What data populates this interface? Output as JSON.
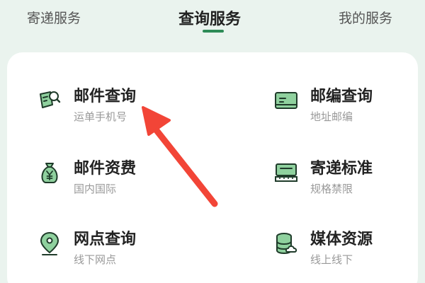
{
  "tabs": [
    {
      "label": "寄递服务",
      "active": false
    },
    {
      "label": "查询服务",
      "active": true
    },
    {
      "label": "我的服务",
      "active": false
    }
  ],
  "services": [
    {
      "title": "邮件查询",
      "subtitle": "运单手机号",
      "icon": "mail-search-icon"
    },
    {
      "title": "邮编查询",
      "subtitle": "地址邮编",
      "icon": "postcode-card-icon"
    },
    {
      "title": "邮件资费",
      "subtitle": "国内国际",
      "icon": "money-bag-icon"
    },
    {
      "title": "寄递标准",
      "subtitle": "规格禁限",
      "icon": "ruler-standard-icon"
    },
    {
      "title": "网点查询",
      "subtitle": "线下网点",
      "icon": "location-pin-icon"
    },
    {
      "title": "媒体资源",
      "subtitle": "线上线下",
      "icon": "database-cloud-icon"
    }
  ],
  "colors": {
    "accent": "#2e8b57",
    "icon_fill": "#8fd19e",
    "icon_stroke": "#1f3b2a",
    "arrow": "#f24537"
  }
}
